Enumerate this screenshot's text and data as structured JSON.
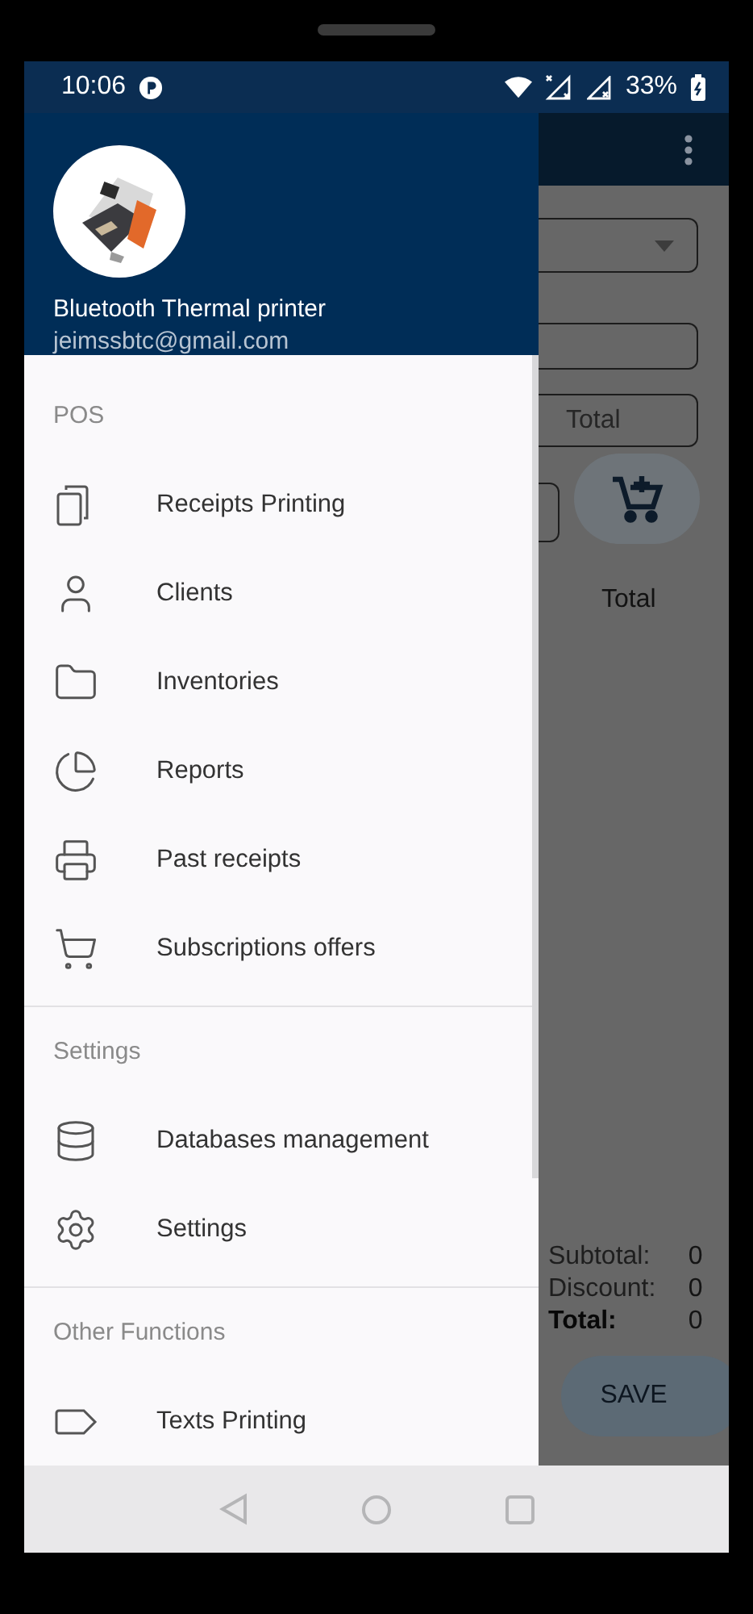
{
  "status_bar": {
    "time": "10:06",
    "battery": "33%"
  },
  "background": {
    "total_placeholder": "Total",
    "total_label": "Total",
    "summary": [
      {
        "label": "Subtotal:",
        "value": "0",
        "bold": false
      },
      {
        "label": "Discount:",
        "value": "0",
        "bold": false
      },
      {
        "label": "Total:",
        "value": "0",
        "bold": true
      }
    ],
    "save_button": "SAVE"
  },
  "drawer": {
    "header": {
      "name": "Bluetooth Thermal printer",
      "email": "jeimssbtc@gmail.com"
    },
    "sections": [
      {
        "title": "POS",
        "items": [
          {
            "label": "Receipts Printing",
            "kind": "copies"
          },
          {
            "label": "Clients",
            "kind": "person"
          },
          {
            "label": "Inventories",
            "kind": "folder"
          },
          {
            "label": "Reports",
            "kind": "pie"
          },
          {
            "label": "Past receipts",
            "kind": "printer"
          },
          {
            "label": "Subscriptions offers",
            "kind": "cart"
          }
        ]
      },
      {
        "title": "Settings",
        "items": [
          {
            "label": "Databases management",
            "kind": "database"
          },
          {
            "label": "Settings",
            "kind": "gear"
          }
        ]
      },
      {
        "title": "Other Functions",
        "items": [
          {
            "label": "Texts Printing",
            "kind": "tag"
          }
        ]
      }
    ]
  }
}
